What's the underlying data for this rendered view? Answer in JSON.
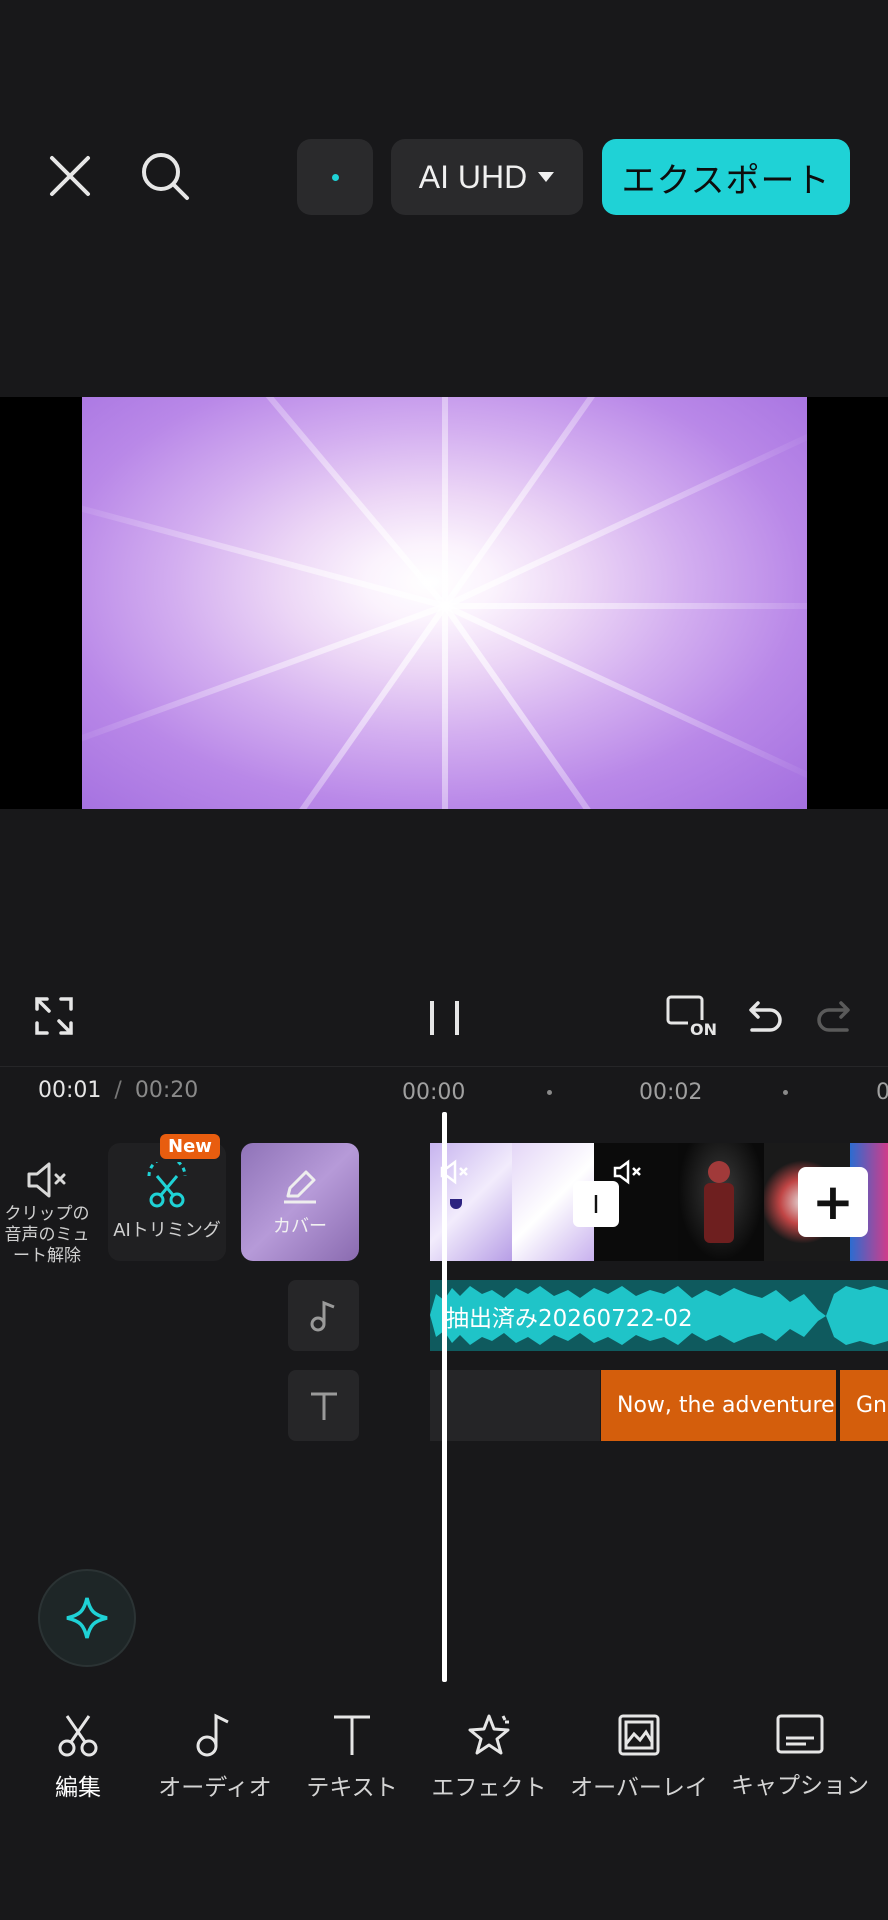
{
  "top_bar": {
    "quality_label": "AI UHD",
    "export_label": "エクスポート",
    "colors": {
      "accent": "#1fd2d6",
      "pill_bg": "#2a2a2c"
    }
  },
  "playback": {
    "current_time": "00:01",
    "separator": "/",
    "total_time": "00:20",
    "ruler": [
      "00:00",
      "00:02",
      "0"
    ]
  },
  "timeline": {
    "mute_label": "クリップの\n音声のミュ\nート解除",
    "ai_trim_label": "AIトリミング",
    "new_badge": "New",
    "cover_label": "カバー",
    "audio_clip_name": "抽出済み20260722-02",
    "text_clips": [
      "Now, the adventure",
      "Gn"
    ],
    "transition_glyph": "I",
    "add_glyph": "+",
    "on_label": "ON"
  },
  "bottom_nav": [
    {
      "label": "編集",
      "icon": "scissors-icon"
    },
    {
      "label": "オーディオ",
      "icon": "music-note-icon"
    },
    {
      "label": "テキスト",
      "icon": "text-icon"
    },
    {
      "label": "エフェクト",
      "icon": "effect-star-icon"
    },
    {
      "label": "オーバーレイ",
      "icon": "overlay-icon"
    },
    {
      "label": "キャプション",
      "icon": "caption-icon"
    }
  ]
}
